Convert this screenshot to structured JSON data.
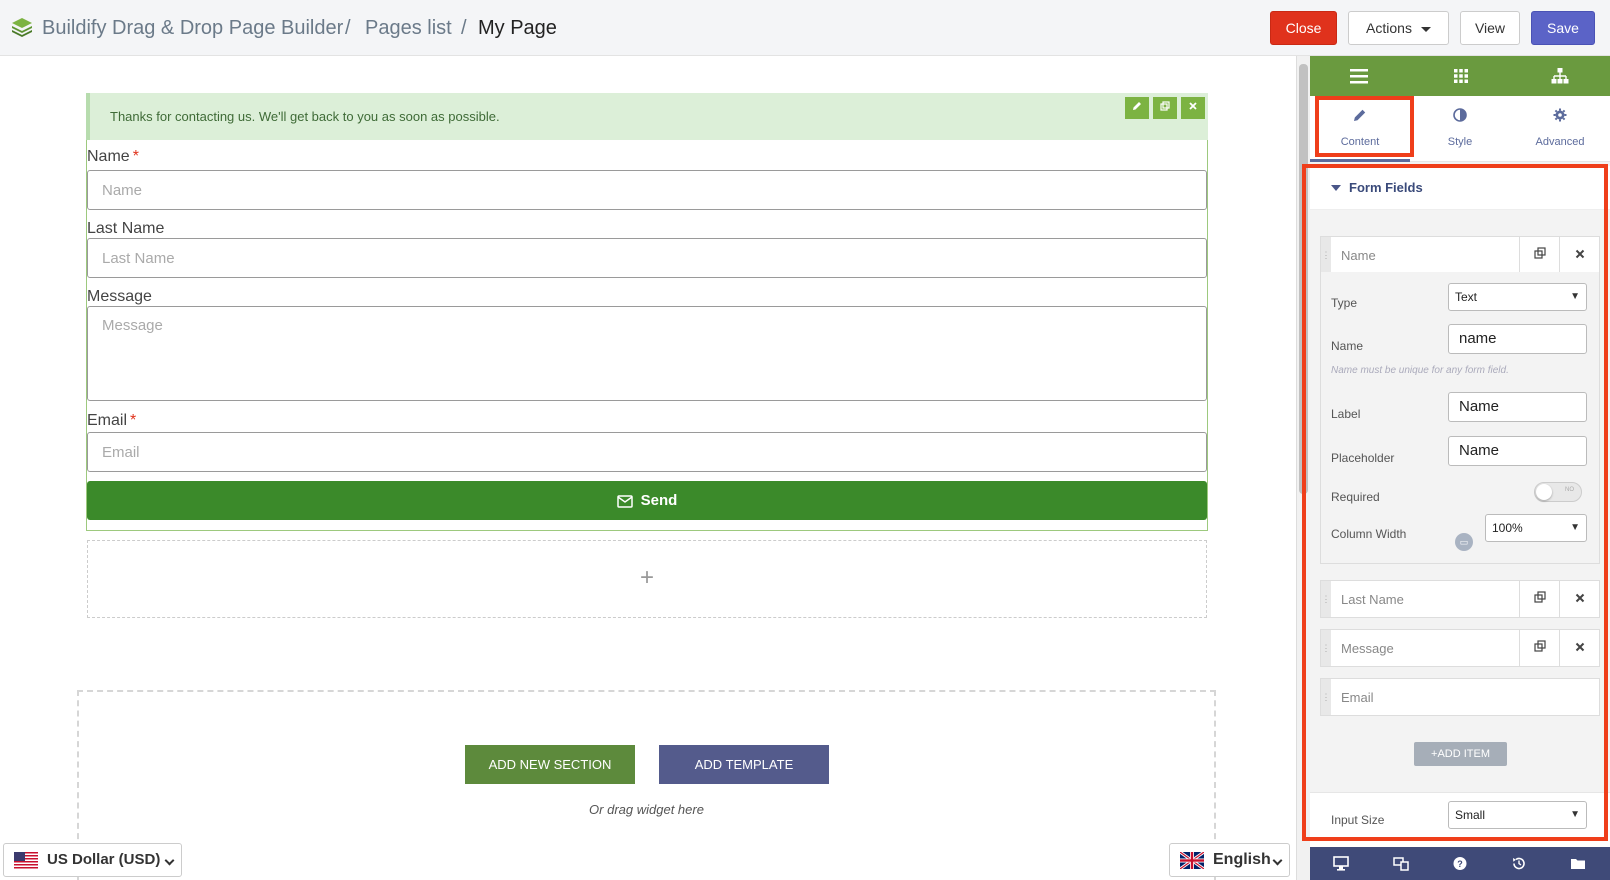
{
  "topbar": {
    "app_title": "Buildify Drag & Drop Page Builder",
    "sep1": "/",
    "crumb_pages": "Pages list",
    "sep2": "/",
    "crumb_current": "My Page",
    "close_label": "Close",
    "actions_label": "Actions",
    "view_label": "View",
    "save_label": "Save"
  },
  "canvas": {
    "alert_text": "Thanks for contacting us. We'll get back to you as soon as possible.",
    "fields": {
      "name_label": "Name",
      "name_placeholder": "Name",
      "lastname_label": "Last Name",
      "lastname_placeholder": "Last Name",
      "message_label": "Message",
      "message_placeholder": "Message",
      "email_label": "Email",
      "email_placeholder": "Email",
      "required_mark": "*"
    },
    "send_label": "Send",
    "add_plus": "+",
    "add_section_label": "ADD NEW SECTION",
    "add_template_label": "ADD TEMPLATE",
    "drag_text": "Or drag widget here"
  },
  "footer": {
    "currency_label": "US Dollar (USD)",
    "language_label": "English"
  },
  "panel": {
    "tabs": [
      {
        "label": "Content"
      },
      {
        "label": "Style"
      },
      {
        "label": "Advanced"
      }
    ],
    "section_title": "Form Fields",
    "items": [
      {
        "title": "Name"
      },
      {
        "title": "Last Name"
      },
      {
        "title": "Message"
      },
      {
        "title": "Email"
      }
    ],
    "editor": {
      "type_label": "Type",
      "type_value": "Text",
      "name_label": "Name",
      "name_value": "name",
      "name_hint": "Name must be unique for any form field.",
      "label_label": "Label",
      "label_value": "Name",
      "placeholder_label": "Placeholder",
      "placeholder_value": "Name",
      "required_label": "Required",
      "required_toggle_text": "NO",
      "column_width_label": "Column Width",
      "column_width_value": "100%"
    },
    "add_item_label": "ADD ITEM",
    "input_size_label": "Input Size",
    "input_size_value": "Small"
  },
  "colors": {
    "close": "#e0321c",
    "save": "#5b63c7",
    "send": "#3b8a2a",
    "panel_top": "#6a9a3f",
    "panel_bottom": "#3f4a78",
    "highlight": "#ef3e1a"
  }
}
